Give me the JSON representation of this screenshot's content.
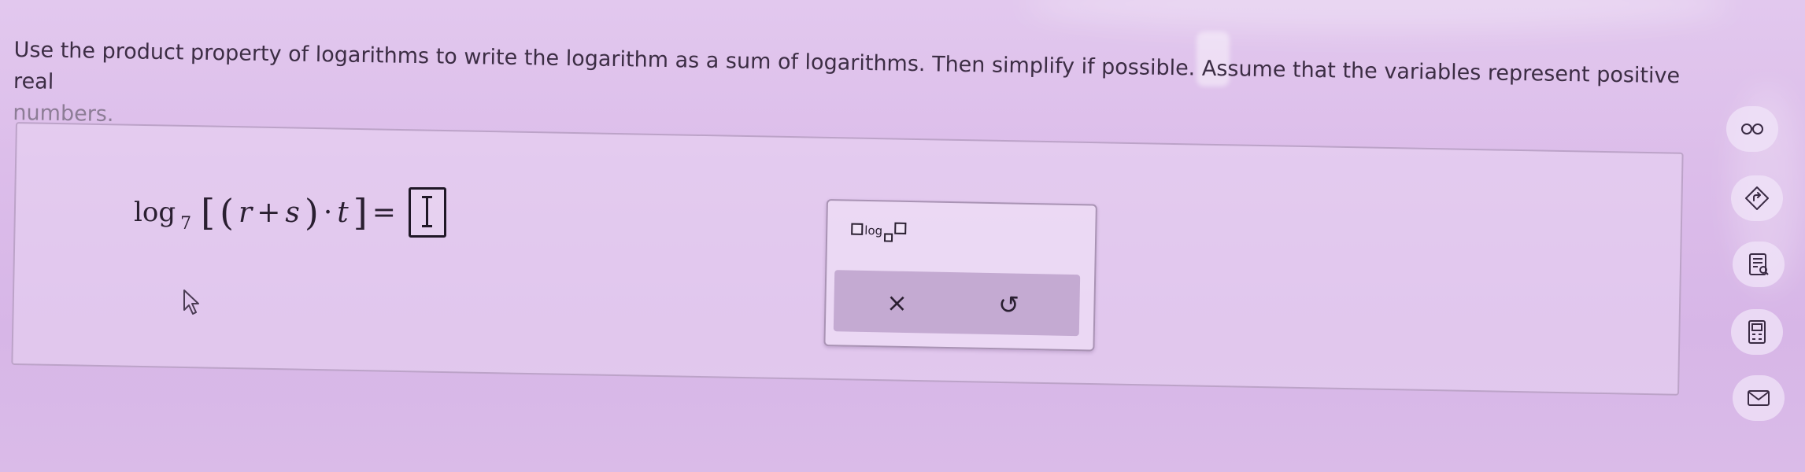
{
  "question": {
    "text_main": "Use the product property of logarithms to write the logarithm as a sum of logarithms. Then simplify if possible. Assume that the variables represent positive real",
    "text_tail": "numbers."
  },
  "equation": {
    "log_word": "log",
    "base": "7",
    "open_bracket": "[",
    "open_paren": "(",
    "var_r": "r",
    "plus": "+",
    "var_s": "s",
    "close_paren": ")",
    "dot": "·",
    "var_t": "t",
    "close_bracket": "]",
    "equals": "="
  },
  "palette": {
    "log_template_text": "log",
    "clear_symbol": "×",
    "undo_symbol": "↺"
  },
  "side_tools": [
    {
      "icon": "glasses-icon"
    },
    {
      "icon": "help-diamond-icon"
    },
    {
      "icon": "textbook-icon"
    },
    {
      "icon": "calculator-icon"
    },
    {
      "icon": "mail-icon"
    }
  ],
  "colors": {
    "background": "#dcbdea",
    "text": "#3c2d44",
    "palette_bar": "#c4aad2"
  }
}
